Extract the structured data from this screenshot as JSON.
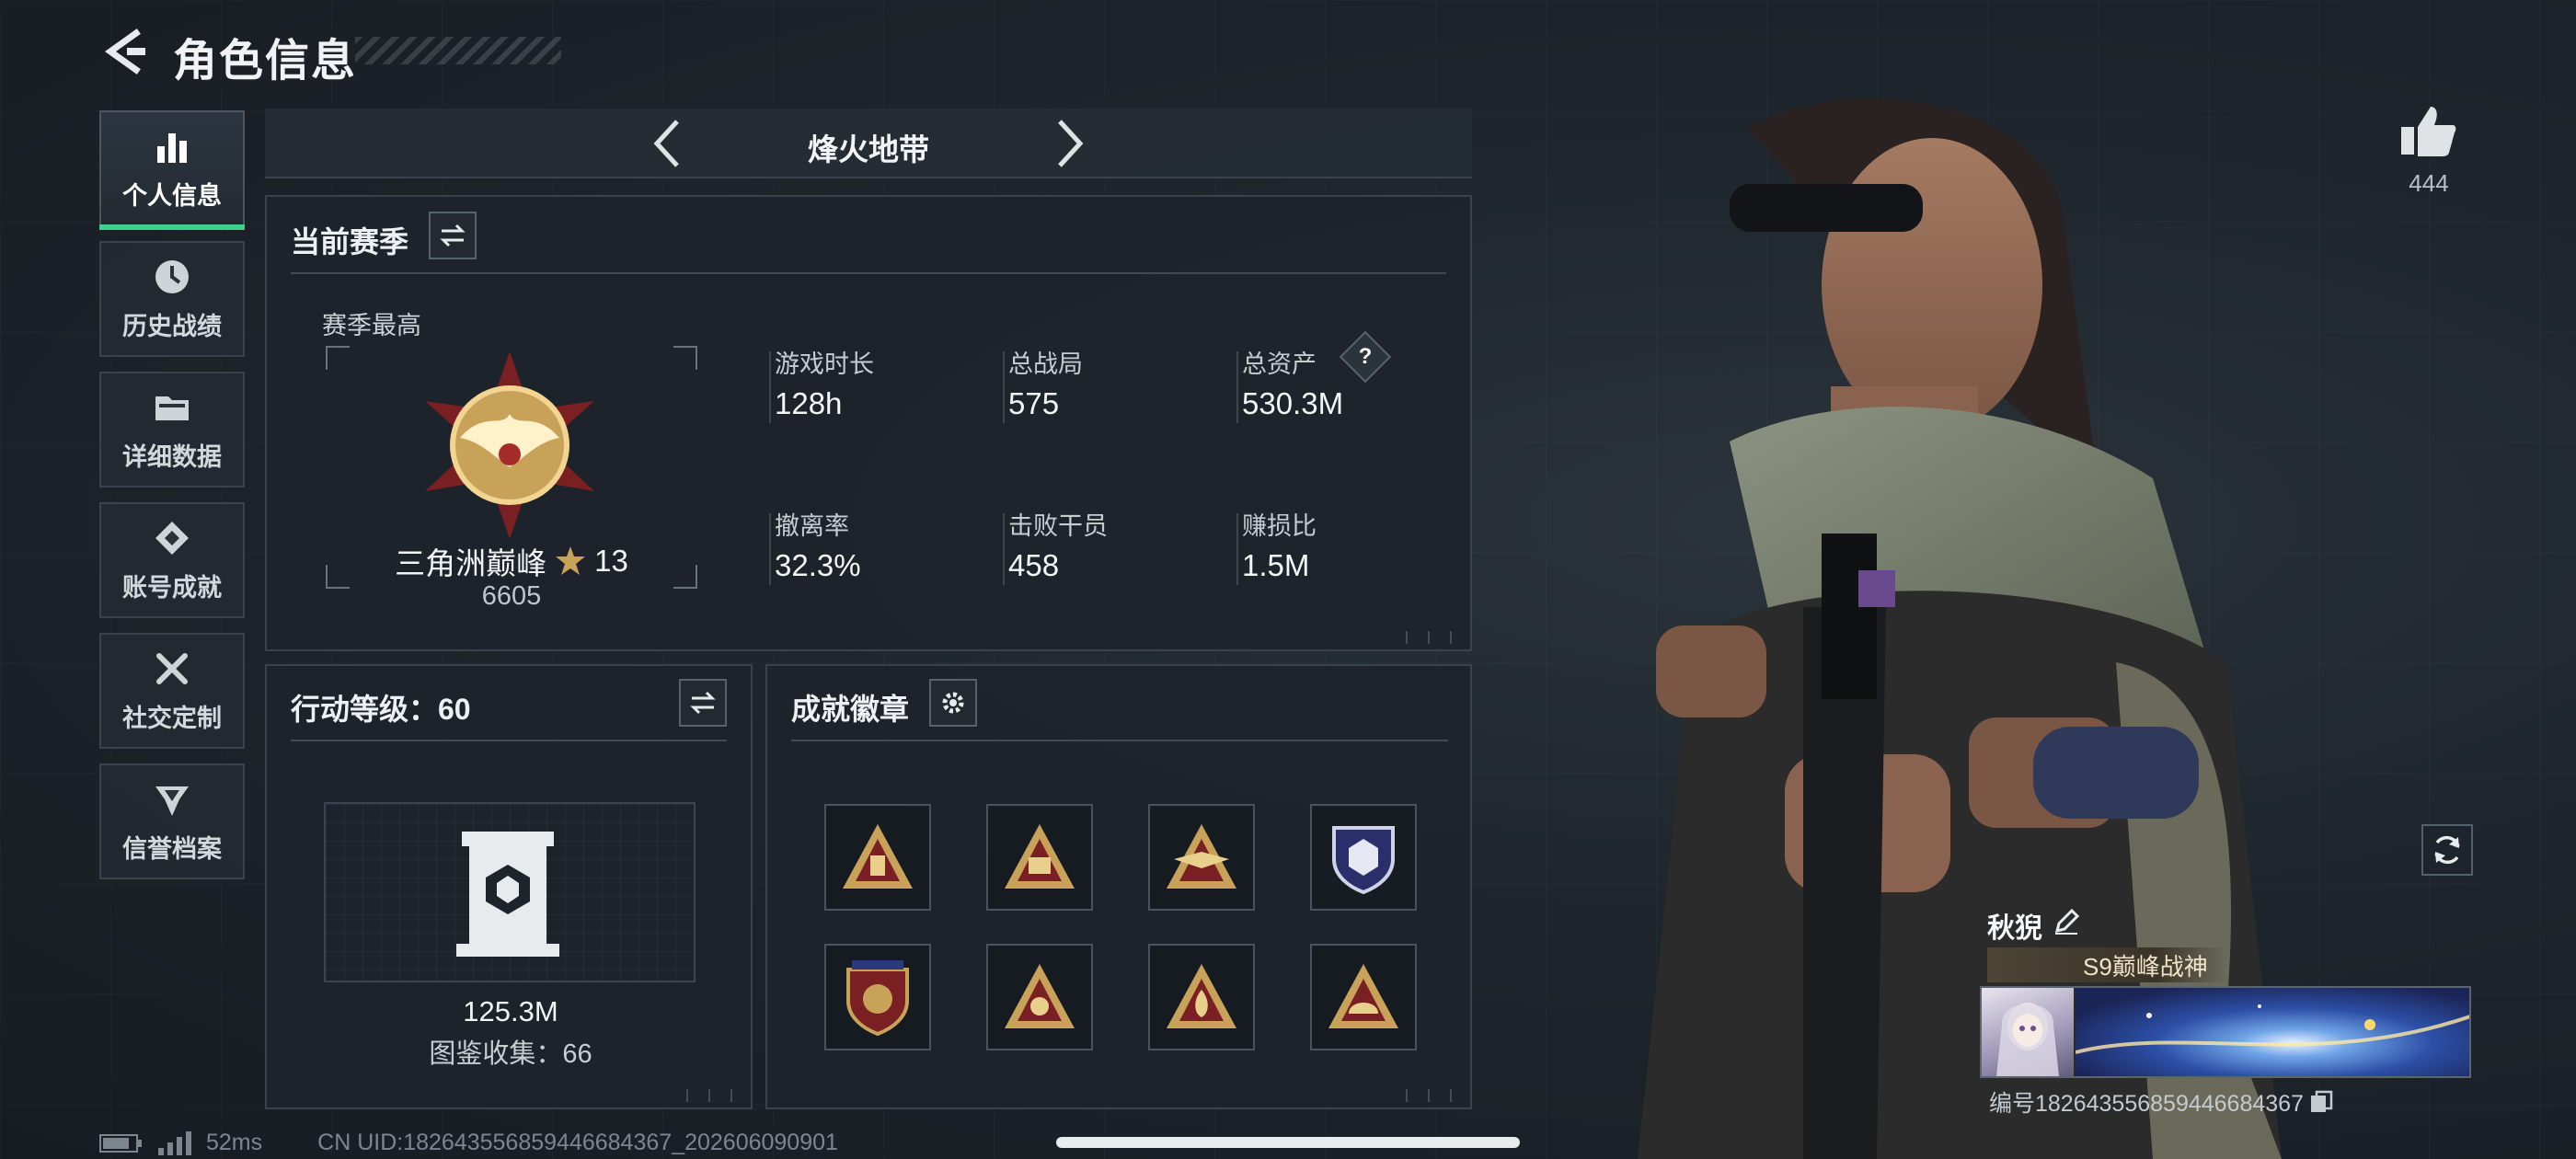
{
  "header": {
    "title": "角色信息"
  },
  "sidebar": {
    "items": [
      {
        "label": "个人信息",
        "icon": "bar-chart-icon",
        "active": true
      },
      {
        "label": "历史战绩",
        "icon": "clock-history-icon"
      },
      {
        "label": "详细数据",
        "icon": "folder-icon"
      },
      {
        "label": "账号成就",
        "icon": "achievement-icon"
      },
      {
        "label": "社交定制",
        "icon": "tools-icon"
      },
      {
        "label": "信誉档案",
        "icon": "credit-shield-icon"
      }
    ]
  },
  "mode_tab": {
    "title": "烽火地带"
  },
  "season": {
    "title": "当前赛季",
    "best_label": "赛季最高",
    "rank_name": "三角洲巅峰",
    "rank_stars": "13",
    "rank_score": "6605",
    "stats": [
      {
        "label": "游戏时长",
        "value": "128h"
      },
      {
        "label": "总战局",
        "value": "575"
      },
      {
        "label": "总资产",
        "value": "530.3M",
        "help": "?"
      },
      {
        "label": "撤离率",
        "value": "32.3%"
      },
      {
        "label": "击败干员",
        "value": "458"
      },
      {
        "label": "赚损比",
        "value": "1.5M"
      }
    ]
  },
  "action_level": {
    "title": "行动等级：60",
    "value": "125.3M",
    "collection": "图鉴收集：66"
  },
  "badges": {
    "title": "成就徽章",
    "items": [
      {
        "icon": "triangle-badge-icon"
      },
      {
        "icon": "s8-triangle-badge-icon"
      },
      {
        "icon": "s9-winged-triangle-badge-icon"
      },
      {
        "icon": "purple-shield-badge-icon"
      },
      {
        "icon": "red-shield-badge-icon"
      },
      {
        "icon": "triangle-emblem-badge-icon"
      },
      {
        "icon": "triangle-fire-badge-icon"
      },
      {
        "icon": "triangle-helmet-badge-icon"
      }
    ]
  },
  "profile": {
    "likes": "444",
    "nickname": "秋猊",
    "title_tag": "S9巅峰战神",
    "uid_line": "编号1826435568594466843​67"
  },
  "status": {
    "ping": "52ms",
    "uid": "CN UID:1826435568594466843​67_202606090901"
  },
  "colors": {
    "accent": "#3fcf8e",
    "gold": "#c9a25a",
    "panel": "#1e242b"
  }
}
